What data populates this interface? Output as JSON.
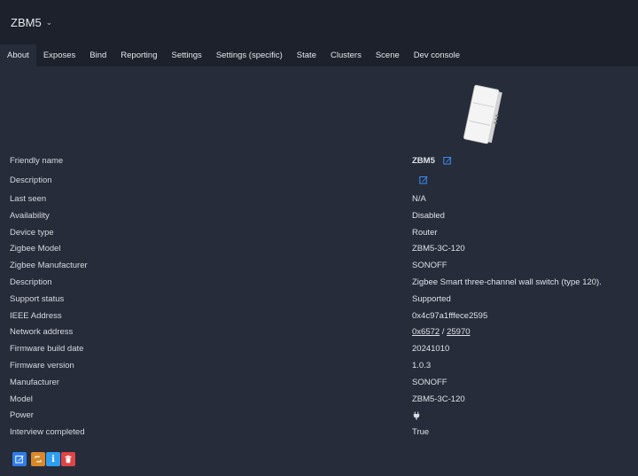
{
  "header": {
    "device_name": "ZBM5"
  },
  "tabs": [
    {
      "label": "About"
    },
    {
      "label": "Exposes"
    },
    {
      "label": "Bind"
    },
    {
      "label": "Reporting"
    },
    {
      "label": "Settings"
    },
    {
      "label": "Settings (specific)"
    },
    {
      "label": "State"
    },
    {
      "label": "Clusters"
    },
    {
      "label": "Scene"
    },
    {
      "label": "Dev console"
    }
  ],
  "active_tab": "About",
  "details": {
    "friendly_name": {
      "label": "Friendly name",
      "value": "ZBM5"
    },
    "description_edit": {
      "label": "Description",
      "value": ""
    },
    "last_seen": {
      "label": "Last seen",
      "value": "N/A"
    },
    "availability": {
      "label": "Availability",
      "value": "Disabled"
    },
    "device_type": {
      "label": "Device type",
      "value": "Router"
    },
    "zigbee_model": {
      "label": "Zigbee Model",
      "value": "ZBM5-3C-120"
    },
    "zigbee_manufacturer": {
      "label": "Zigbee Manufacturer",
      "value": "SONOFF"
    },
    "description": {
      "label": "Description",
      "value": "Zigbee Smart three-channel wall switch (type 120)."
    },
    "support_status": {
      "label": "Support status",
      "value": "Supported"
    },
    "ieee_address": {
      "label": "IEEE Address",
      "value": "0x4c97a1fffece2595"
    },
    "network_address": {
      "label": "Network address",
      "hex": "0x6572",
      "sep": " / ",
      "dec": "25970"
    },
    "firmware_build_date": {
      "label": "Firmware build date",
      "value": "20241010"
    },
    "firmware_version": {
      "label": "Firmware version",
      "value": "1.0.3"
    },
    "manufacturer": {
      "label": "Manufacturer",
      "value": "SONOFF"
    },
    "model": {
      "label": "Model",
      "value": "ZBM5-3C-120"
    },
    "power": {
      "label": "Power",
      "icon": "plug-icon"
    },
    "interview_completed": {
      "label": "Interview completed",
      "value": "True"
    }
  },
  "actions": [
    {
      "name": "rename",
      "icon": "edit-icon",
      "color": "#2f7de9"
    },
    {
      "name": "reconfigure",
      "icon": "refresh-icon",
      "color": "#d9892a"
    },
    {
      "name": "interview",
      "icon": "info-icon",
      "color": "#2f9ef0"
    },
    {
      "name": "remove",
      "icon": "trash-icon",
      "color": "#e04545"
    }
  ],
  "colors": {
    "background": "#262c3a",
    "topbar": "#1c212c",
    "link": "#3c8ff5",
    "supported": "#3ec76b"
  }
}
